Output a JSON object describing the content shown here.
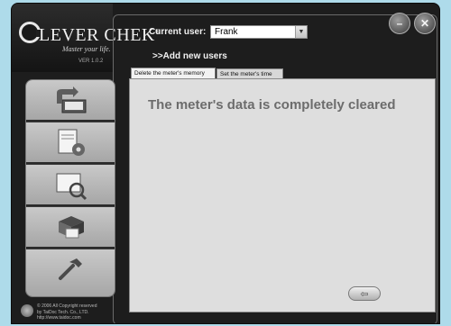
{
  "brand": {
    "logo_text": "LEVER CHEK",
    "trademark": "®",
    "tagline": "Master your life.",
    "version": "VER  1.0.2"
  },
  "window_controls": {
    "minimize_icon": "minus-icon",
    "close_icon": "close-icon"
  },
  "header": {
    "current_user_label": "Current user:",
    "current_user_value": "Frank",
    "add_users_link": ">>Add new users"
  },
  "sidebar": {
    "items": [
      {
        "icon": "download-to-pc-icon"
      },
      {
        "icon": "settings-document-icon"
      },
      {
        "icon": "search-document-icon"
      },
      {
        "icon": "printer-icon"
      },
      {
        "icon": "hammer-tool-icon"
      }
    ]
  },
  "tabs": [
    {
      "label": "Delete the meter's memory",
      "active": true
    },
    {
      "label": "Set the meter's time",
      "active": false
    }
  ],
  "panel": {
    "message": "The meter's data is completely cleared",
    "back_button_icon": "back-arrow-icon"
  },
  "footer": {
    "lines": [
      "© 2006 All Copyright reserved",
      "by TaiDoc Tech. Co., LTD.",
      "http://www.taidoc.com"
    ]
  }
}
